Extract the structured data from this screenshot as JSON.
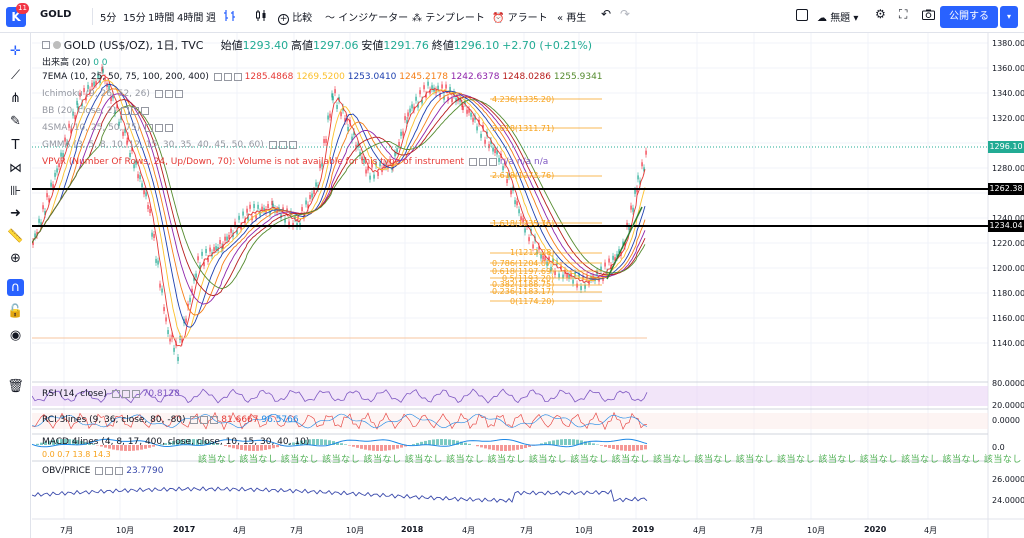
{
  "toolbar": {
    "logo_letter": "K",
    "logo_badge": "11",
    "symbol": "GOLD",
    "intervals": [
      "5分",
      "15分",
      "1時間",
      "4時間",
      "週"
    ],
    "compare_label": "比較",
    "indicators_label": "インジケーター",
    "templates_label": "テンプレート",
    "alert_label": "アラート",
    "replay_label": "再生",
    "layout_name": "無題",
    "publish_label": "公開する"
  },
  "legend": {
    "title": "GOLD (US$/OZ), 1日, TVC",
    "open_label": "始値",
    "open": "1293.40",
    "high_label": "高値",
    "high": "1297.06",
    "low_label": "安値",
    "low": "1291.76",
    "close_label": "終値",
    "close": "1296.10",
    "change": "+2.70 (+0.21%)"
  },
  "indicators": {
    "volume": "出来高 (20)",
    "volume_vals": "0  0",
    "ema_label": "7EMA (10, 25, 50, 75, 100, 200, 400)",
    "ema_values": [
      "1285.4868",
      "1269.5200",
      "1253.0410",
      "1245.2178",
      "1242.6378",
      "1248.0286",
      "1255.9341"
    ],
    "ema_colors": [
      "#e53935",
      "#fbc02d",
      "#1e40af",
      "#f57f17",
      "#8e24aa",
      "#b71c1c",
      "#558b2f"
    ],
    "ichimoku": "Ichimoku (9, 26, 52, 26)",
    "bb": "BB (20, close, 2)",
    "sma": "4SMA (10, 25, 50, 75)",
    "gmma": "GMMA (3, 5, 8, 10, 12, 15, 30, 35, 40, 45, 50, 60)",
    "vpvr": "VPVR (Number Of Rows, 24, Up/Down, 70): Volume is not available for this type of instrument",
    "vpvr_na": "n/a  n/a  n/a"
  },
  "price_axis": {
    "ticks": [
      "1380.00",
      "1360.00",
      "1340.00",
      "1320.00",
      "1300.00",
      "1280.00",
      "1260.00",
      "1240.00",
      "1220.00",
      "1200.00",
      "1180.00",
      "1160.00",
      "1140.00"
    ],
    "current_price": "1296.10",
    "hline_1": "1262.38",
    "hline_2": "1234.04"
  },
  "fibonacci": {
    "levels": [
      "4.236(1335.20)",
      "3.618(1311.71)",
      "2.618(1273.76)",
      "1.618(1235.76)",
      "1(1212.28)",
      "0.786(1204.07)",
      "0.618(1197.69)",
      "0.5(1193.20)",
      "0.382(1188.75)",
      "0.236(1183.17)",
      "0(1174.20)"
    ]
  },
  "rsi": {
    "label": "RSI (14, close)",
    "value": "70.8128",
    "ticks": [
      "80.0000",
      "20.0000"
    ]
  },
  "rci": {
    "label": "RCI 3lines (9, 36, close, 80, -80)",
    "value1": "81.6667",
    "value2": "96.5766",
    "tick": "0.0000"
  },
  "macd": {
    "label": "MACD 4lines (4, 8, 17, 400, close, close, 10, 15, 30, 40, 10)",
    "vals": "0.0  0.7  13.8  14.3",
    "tick": "0.0",
    "nodata": "該当なし 該当なし 該当なし 該当なし 該当なし 該当なし 該当なし 該当なし 該当なし 該当なし 該当なし 該当なし 該当なし 該当なし 該当なし 該当なし 該当なし 該当なし 該当なし 該当なし"
  },
  "obv": {
    "label": "OBV/PRICE",
    "value": "23.7790",
    "ticks": [
      "26.0000",
      "24.0000"
    ]
  },
  "time_axis": {
    "ticks": [
      "7月",
      "10月",
      "2017",
      "4月",
      "7月",
      "10月",
      "2018",
      "4月",
      "7月",
      "10月",
      "2019",
      "4月",
      "7月",
      "10月",
      "2020",
      "4月"
    ]
  },
  "colors": {
    "accent": "#2962ff",
    "up": "#22ab94",
    "down": "#f23645",
    "fib": "#f7a21b",
    "rsi_band": "#e9d3f5"
  }
}
